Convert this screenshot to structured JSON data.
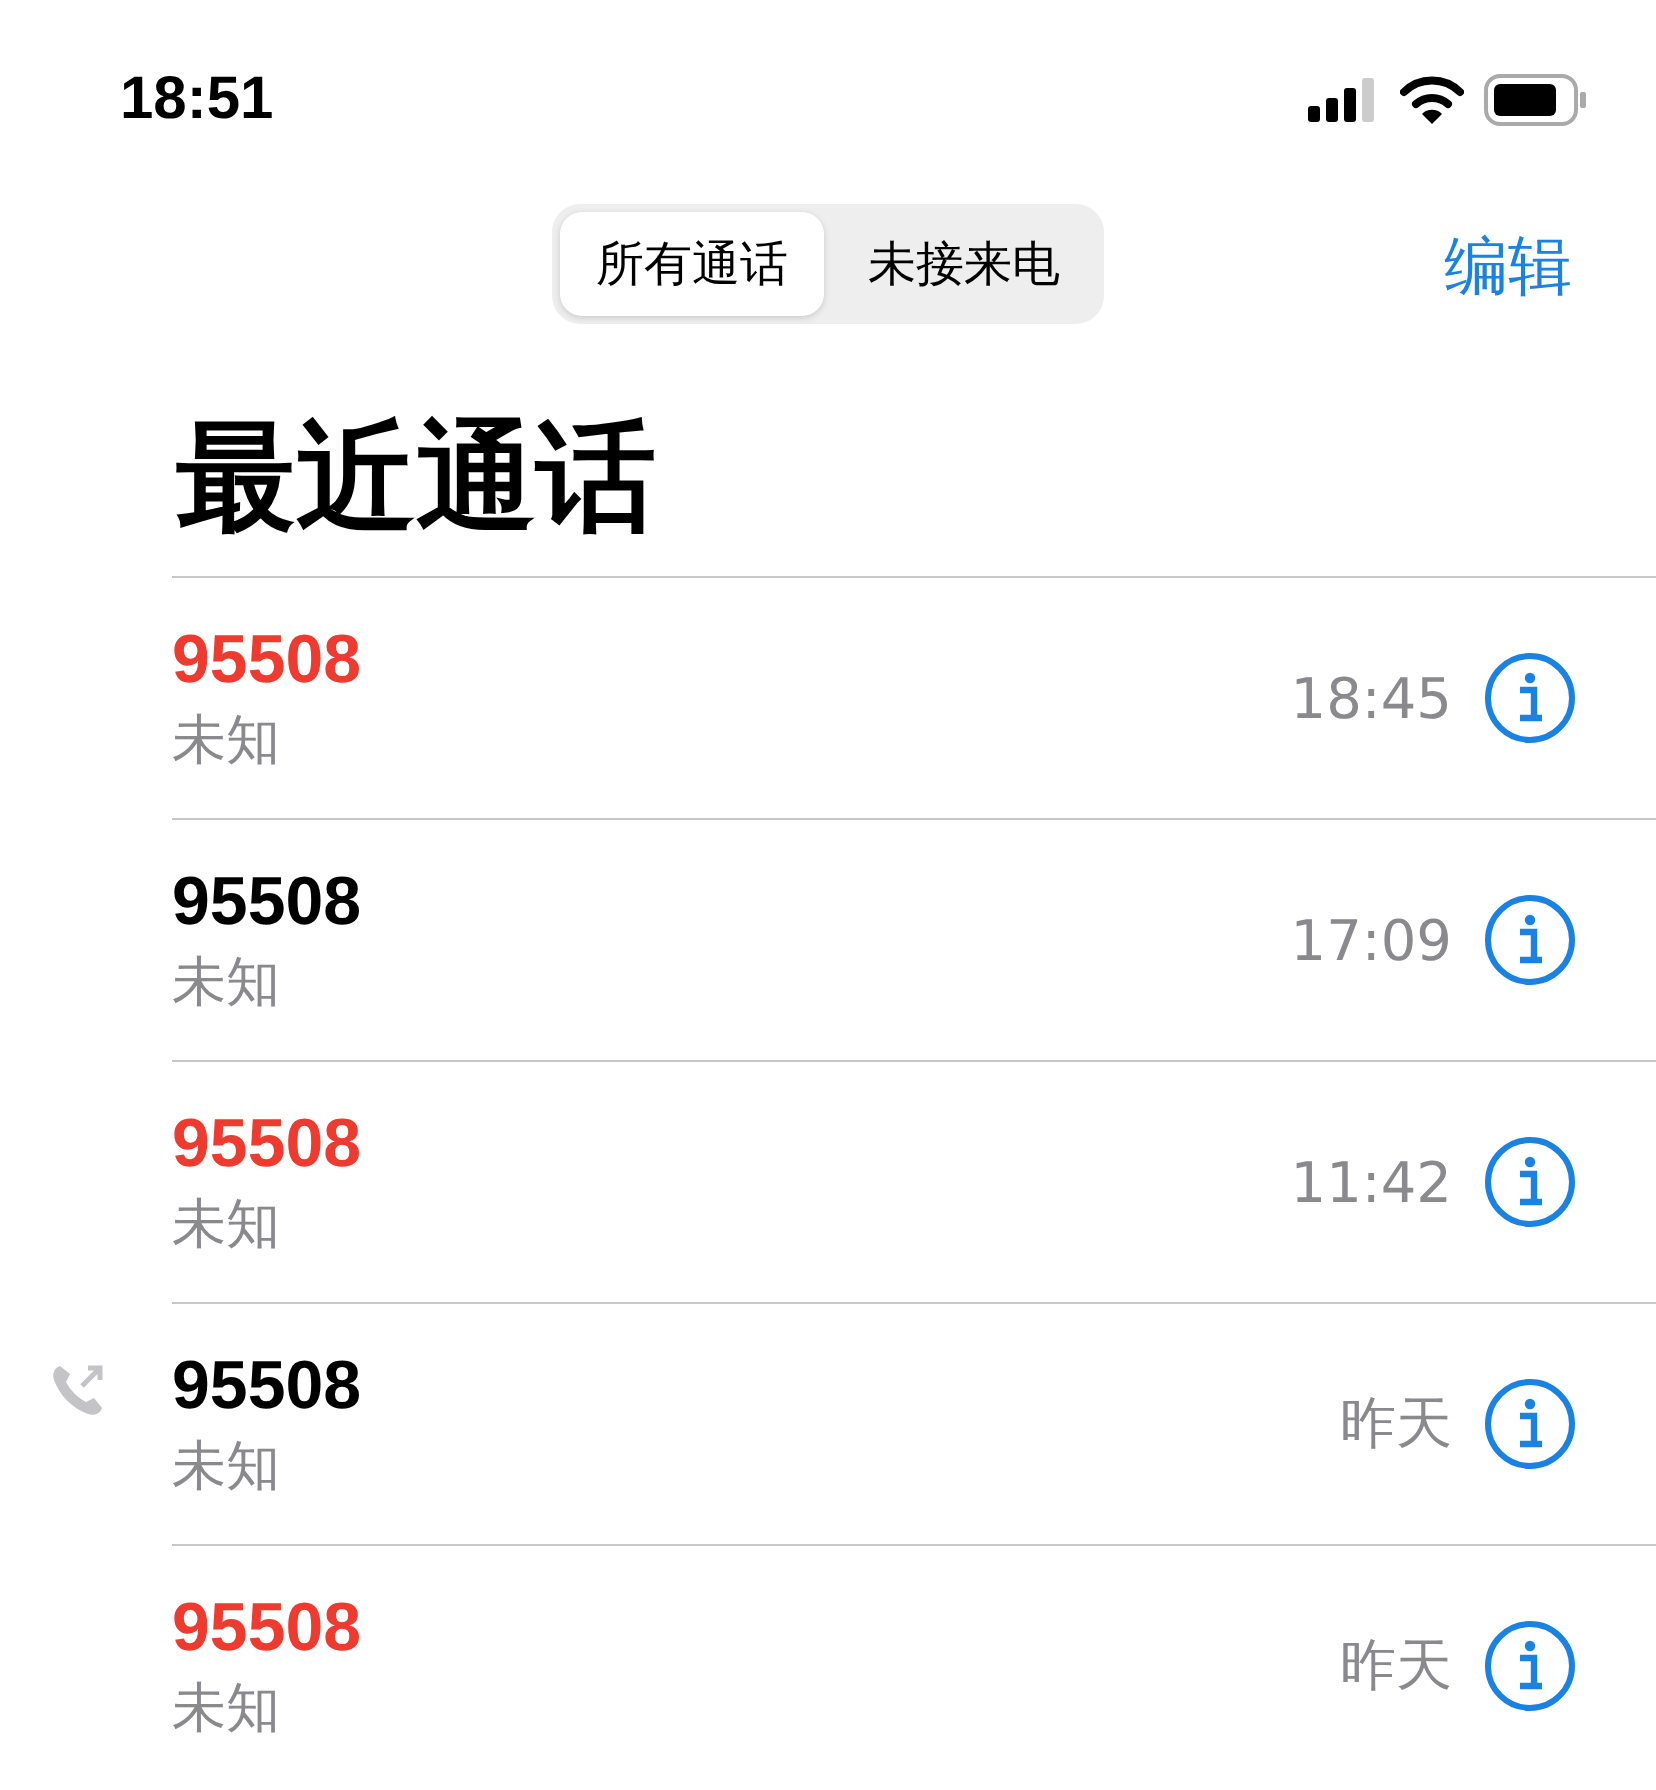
{
  "status_bar": {
    "time": "18:51"
  },
  "segments": [
    {
      "label": "所有通话",
      "selected": true
    },
    {
      "label": "未接来电",
      "selected": false
    }
  ],
  "edit_button": "编辑",
  "title": "最近通话",
  "calls": [
    {
      "number": "95508",
      "label": "未知",
      "time": "18:45",
      "missed": true,
      "outgoing": false
    },
    {
      "number": "95508",
      "label": "未知",
      "time": "17:09",
      "missed": false,
      "outgoing": false
    },
    {
      "number": "95508",
      "label": "未知",
      "time": "11:42",
      "missed": true,
      "outgoing": false
    },
    {
      "number": "95508",
      "label": "未知",
      "time": "昨天",
      "missed": false,
      "outgoing": true
    },
    {
      "number": "95508",
      "label": "未知",
      "time": "昨天",
      "missed": true,
      "outgoing": false
    }
  ]
}
